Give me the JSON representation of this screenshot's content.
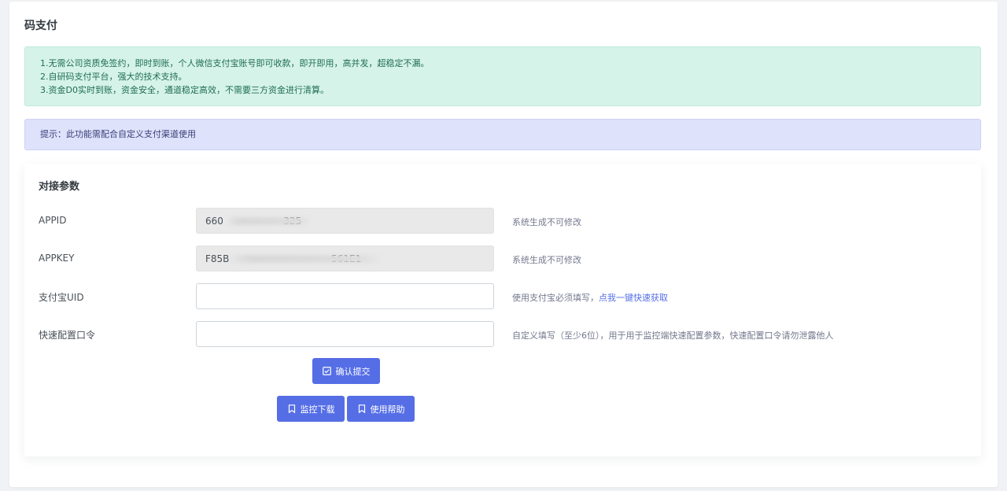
{
  "page": {
    "title": "码支付"
  },
  "notice": {
    "lines": [
      "1.无需公司资质免签约，即时到账，个人微信支付宝账号即可收款，即开即用，高并发，超稳定不漏。",
      "2.自研码支付平台，强大的技术支持。",
      "3.资金D0实时到账，资金安全，通道稳定高效，不需要三方资金进行清算。"
    ]
  },
  "tip": {
    "text": "提示：此功能需配合自定义支付渠道使用"
  },
  "form": {
    "section_title": "对接参数",
    "appid": {
      "label": "APPID",
      "value": "660                    325",
      "help": "系统生成不可修改"
    },
    "appkey": {
      "label": "APPKEY",
      "value": "F85B                                  561E1",
      "help": "系统生成不可修改"
    },
    "alipay_uid": {
      "label": "支付宝UID",
      "value": "",
      "help": "使用支付宝必须填写，",
      "help_link": "点我一键快速获取"
    },
    "quick_token": {
      "label": "快速配置口令",
      "value": "",
      "help": "自定义填写（至少6位），用于用于监控端快速配置参数，快速配置口令请勿泄露他人"
    },
    "submit_label": "确认提交",
    "download_label": "监控下载",
    "help_label": "使用帮助"
  },
  "icons": {
    "submit": "checkbox-icon",
    "download": "bookmark-icon",
    "help": "bookmark-icon"
  },
  "colors": {
    "primary": "#556ee6",
    "success_bg": "#d6f3e9",
    "info_bg": "#dee2fb"
  }
}
